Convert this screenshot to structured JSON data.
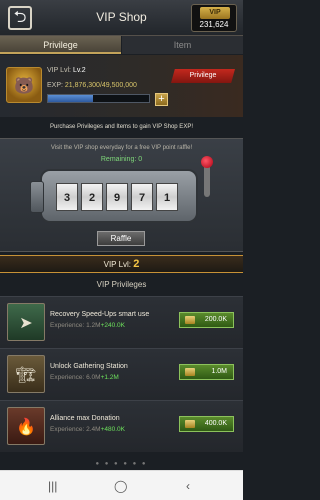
{
  "header": {
    "back_label": "⮌",
    "title": "VIP Shop",
    "vip_badge": "VIP",
    "currency_amount": "231,624"
  },
  "tabs": [
    {
      "label": "Privilege"
    },
    {
      "label": "Item"
    }
  ],
  "profile": {
    "vip_label": "VIP Lvl:",
    "vip_value": "Lv.2",
    "exp_label": "EXP:",
    "exp_value": "21,876,300/49,500,000",
    "exp_progress": 0.442,
    "plus_label": "+",
    "privilege_tag": "Privilege"
  },
  "info_text": "Purchase Privileges and Items to gain VIP Shop EXP!",
  "raffle": {
    "text": "Visit the VIP shop everyday for a free VIP point raffle!",
    "remaining": "Remaining: 0",
    "digits": [
      "3",
      "2",
      "9",
      "7",
      "1"
    ],
    "button": "Raffle"
  },
  "vip_strip": {
    "label": "VIP Lvl:",
    "value": "2"
  },
  "privileges_title": "VIP Privileges",
  "privileges": [
    {
      "name": "Recovery Speed-Ups smart use",
      "exp_label": "Experience:",
      "exp_value": "1.2M",
      "gain": "+240.0K",
      "price": "200.0K",
      "icon": "arrow-speedup-icon"
    },
    {
      "name": "Unlock Gathering Station",
      "exp_label": "Experience:",
      "exp_value": "6.0M",
      "gain": "+1.2M",
      "price": "1.0M",
      "icon": "gathering-station-icon"
    },
    {
      "name": "Alliance max Donation",
      "exp_label": "Experience:",
      "exp_value": "2.4M",
      "gain": "+480.0K",
      "price": "400.0K",
      "icon": "donation-icon"
    }
  ],
  "pager": {
    "dots": "● ● ● ● ● ●"
  },
  "system_nav": {
    "recent": "|||",
    "home": "◯",
    "back": "‹"
  }
}
